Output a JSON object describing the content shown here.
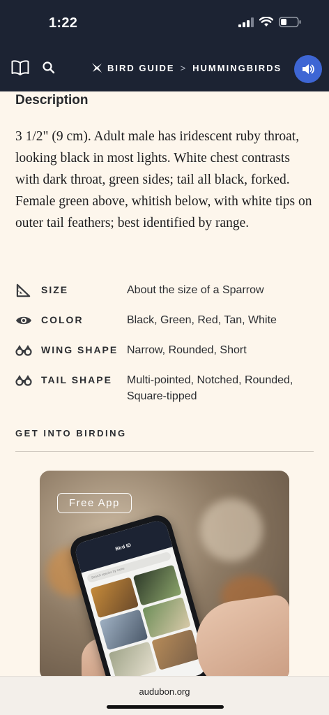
{
  "status": {
    "time": "1:22"
  },
  "nav": {
    "breadcrumb": [
      {
        "label": "BIRD GUIDE"
      },
      {
        "label": "HUMMINGBIRDS"
      }
    ],
    "separator": ">"
  },
  "description": {
    "heading": "Description",
    "text": "3 1/2\" (9 cm). Adult male has iridescent ruby throat, looking black in most lights. White chest contrasts with dark throat, green sides; tail all black, forked. Female green above, whitish below, with white tips on outer tail feathers; best identified by range."
  },
  "attributes": [
    {
      "icon": "ruler-triangle-icon",
      "label": "SIZE",
      "value": "About the size of a Sparrow"
    },
    {
      "icon": "eye-icon",
      "label": "COLOR",
      "value": "Black, Green, Red, Tan, White"
    },
    {
      "icon": "binoculars-icon",
      "label": "WING SHAPE",
      "value": "Narrow, Rounded, Short"
    },
    {
      "icon": "binoculars-icon",
      "label": "TAIL SHAPE",
      "value": "Multi-pointed, Notched, Rounded, Square-tipped"
    }
  ],
  "birding": {
    "heading": "GET INTO BIRDING",
    "badge": "Free App",
    "app_title": "Bird ID",
    "app_search": "Search species by name"
  },
  "browser": {
    "url": "audubon.org"
  },
  "colors": {
    "nav_bg": "#1c2333",
    "accent": "#3e66d4",
    "page_bg": "#fdf6ec"
  }
}
